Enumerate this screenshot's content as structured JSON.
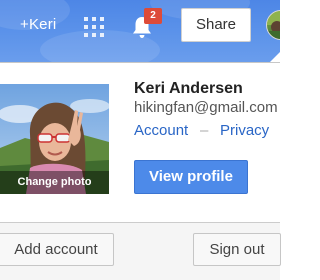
{
  "topbar": {
    "plus_name": "+Keri",
    "apps_icon": "apps-grid-icon",
    "notification_icon": "bell-icon",
    "notification_count": "2",
    "share_label": "Share"
  },
  "account": {
    "name": "Keri Andersen",
    "email": "hikingfan@gmail.com",
    "account_link": "Account",
    "separator": "–",
    "privacy_link": "Privacy",
    "change_photo_label": "Change photo",
    "view_profile_label": "View profile"
  },
  "footer": {
    "add_account_label": "Add account",
    "sign_out_label": "Sign out"
  },
  "colors": {
    "topbar": "#5c93ea",
    "badge": "#dd4b39",
    "link": "#2a66c6",
    "primary_button": "#4d8ae9"
  }
}
